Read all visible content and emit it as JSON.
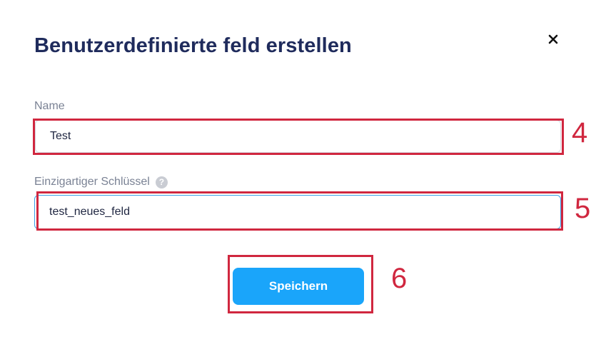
{
  "dialog": {
    "title": "Benutzerdefinierte feld erstellen",
    "close_icon": "close-icon"
  },
  "form": {
    "name_label": "Name",
    "name_value": "Test",
    "key_label": "Einzigartiger Schlüssel",
    "key_help_icon": "help-icon",
    "key_help_glyph": "?",
    "key_value": "test_neues_feld",
    "save_label": "Speichern"
  },
  "annotations": {
    "step_name": "4",
    "step_key": "5",
    "step_save": "6",
    "color": "#d0273f"
  },
  "colors": {
    "title": "#1f2b5c",
    "button": "#1aa5fa",
    "focused_border": "#3aa0e8"
  }
}
